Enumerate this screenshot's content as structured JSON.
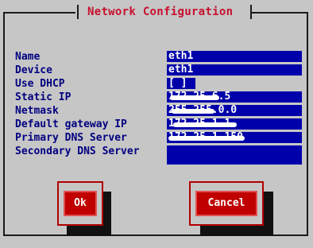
{
  "dialog": {
    "title": "Network Configuration"
  },
  "form": {
    "fields": [
      {
        "label": "Name",
        "value": "eth1"
      },
      {
        "label": "Device",
        "value": "eth1"
      },
      {
        "label": "Use DHCP",
        "value": "[ ]"
      },
      {
        "label": "Static IP",
        "value": "172.25.6.5"
      },
      {
        "label": "Netmask",
        "value": "255.255.0.0"
      },
      {
        "label": "Default gateway IP",
        "value": "172.25.1.1"
      },
      {
        "label": "Primary DNS Server",
        "value": "172.25.1.150"
      },
      {
        "label": "Secondary DNS Server",
        "value": ""
      }
    ]
  },
  "buttons": {
    "ok": "Ok",
    "cancel": "Cancel"
  },
  "colors": {
    "field_bg": "#0000aa",
    "label": "#000080",
    "title": "#c8102e",
    "button": "#c00000"
  }
}
